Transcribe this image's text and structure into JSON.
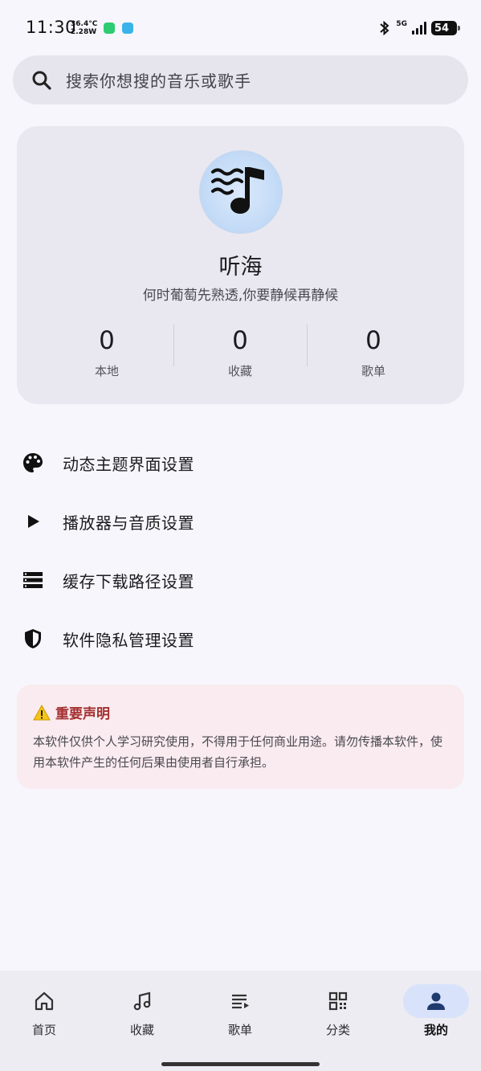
{
  "status_bar": {
    "time": "11:30",
    "temperature": "36.4°C",
    "power": "2.28W",
    "network": "5G",
    "battery": "54"
  },
  "search": {
    "placeholder": "搜索你想搜的音乐或歌手",
    "icon": "search-icon"
  },
  "profile": {
    "avatar_icon": "music-note-waves-icon",
    "name": "听海",
    "motto": "何时葡萄先熟透,你要静候再静候",
    "stats": [
      {
        "value": "0",
        "label": "本地"
      },
      {
        "value": "0",
        "label": "收藏"
      },
      {
        "value": "0",
        "label": "歌单"
      }
    ]
  },
  "menu": [
    {
      "icon": "palette-icon",
      "label": "动态主题界面设置"
    },
    {
      "icon": "play-icon",
      "label": "播放器与音质设置"
    },
    {
      "icon": "storage-list-icon",
      "label": "缓存下载路径设置"
    },
    {
      "icon": "shield-icon",
      "label": "软件隐私管理设置"
    }
  ],
  "notice": {
    "icon": "warning-icon",
    "title": "重要声明",
    "body": "本软件仅供个人学习研究使用，不得用于任何商业用途。请勿传播本软件，使用本软件产生的任何后果由使用者自行承担。"
  },
  "bottom_nav": {
    "active_index": 4,
    "items": [
      {
        "icon": "home-icon",
        "label": "首页"
      },
      {
        "icon": "music-note-icon",
        "label": "收藏"
      },
      {
        "icon": "playlist-icon",
        "label": "歌单"
      },
      {
        "icon": "grid-icon",
        "label": "分类"
      },
      {
        "icon": "person-icon",
        "label": "我的"
      }
    ]
  },
  "colors": {
    "background": "#f7f6fc",
    "card": "#e9e8f0",
    "notice_background": "#f9ebef",
    "notice_title": "#a4302f",
    "nav_active_pill": "#d8e2fb"
  }
}
